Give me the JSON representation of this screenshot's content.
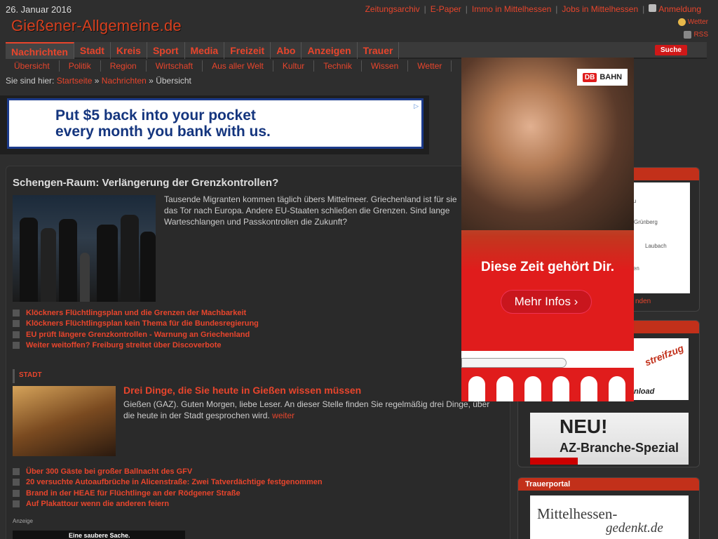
{
  "header": {
    "date": "26. Januar 2016",
    "logo": "Gießener-Allgemeine.de",
    "toplinks": [
      "Zeitungsarchiv",
      "E-Paper",
      "Immo in Mittelhessen",
      "Jobs in Mittelhessen",
      "Anmeldung"
    ],
    "weather": "Wetter",
    "rss": "RSS"
  },
  "nav": {
    "main": [
      "Nachrichten",
      "Stadt",
      "Kreis",
      "Sport",
      "Media",
      "Freizeit",
      "Abo",
      "Anzeigen",
      "Trauer"
    ],
    "search": "Suche",
    "sub": [
      "Übersicht",
      "Politik",
      "Region",
      "Wirtschaft",
      "Aus aller Welt",
      "Kultur",
      "Technik",
      "Wissen",
      "Wetter"
    ]
  },
  "breadcrumb": {
    "prefix": "Sie sind hier:",
    "home": "Startseite",
    "sep": "»",
    "section": "Nachrichten",
    "current": "Übersicht"
  },
  "banner": {
    "line1": "Put $5 back into your pocket",
    "line2": "every month you bank with us."
  },
  "article": {
    "title": "Schengen-Raum: Verlängerung der Grenzkontrollen?",
    "teaser": "Tausende Migranten kommen täglich übers Mittelmeer. Griechenland ist für sie das Tor nach Europa. Andere EU-Staaten schließen die Grenzen. Sind lange Warteschlangen und Passkontrollen die Zukunft?",
    "related": [
      "Klöckners Flüchtlingsplan und die Grenzen der Machbarkeit",
      "Klöckners Flüchtlingsplan kein Thema für die Bundesregierung",
      "EU prüft längere Grenzkontrollen - Warnung an Griechenland",
      "Weiter weitoffen? Freiburg streitet über Discoverbote"
    ]
  },
  "stadt": {
    "label": "STADT",
    "title": "Drei Dinge, die Sie heute in Gießen wissen müssen",
    "teaser": "Gießen (GAZ). Guten Morgen, liebe Leser. An dieser Stelle finden Sie regelmäßig drei Dinge, über die heute in der Stadt gesprochen wird.",
    "more": "weiter",
    "related": [
      "Über 300 Gäste bei großer Ballnacht des GFV",
      "20 versuchte Autoaufbrüche in Alicenstraße: Zwei Tatverdächtige festgenommen",
      "Brand in der HEAE für Flüchtlinge an der Rödgener Straße",
      "Auf Plakattour wenn die anderen feiern"
    ],
    "anzeige": "Anzeige",
    "small_ad": "Eine saubere Sache."
  },
  "sidebar": {
    "map_labels": [
      "Grünberg",
      "Laubach"
    ],
    "map_link": "nden",
    "streifzug": "streifzug",
    "streifzug_sub": "nload",
    "neu": "NEU!",
    "neu_sub": "AZ-Branche-Spezial",
    "trauer_head": "Trauerportal",
    "gedenkt1": "Mittelhessen-",
    "gedenkt2": "gedenkt.de"
  },
  "db_ad": {
    "db": "DB",
    "bahn": "BAHN",
    "slogan": "Diese Zeit gehört Dir.",
    "button": "Mehr Infos ›"
  }
}
